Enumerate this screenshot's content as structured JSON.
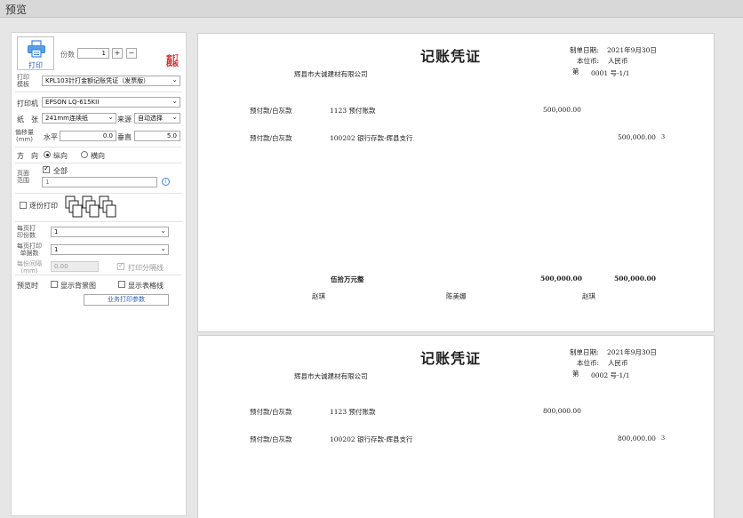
{
  "window": {
    "title": "预览"
  },
  "settings": {
    "print_label": "打印",
    "copies_label": "份数",
    "copies_value": "1",
    "plus": "+",
    "minus": "−",
    "overprint_label": "套打\n模板",
    "template_label": "打印\n模板",
    "template_value": "KPL103针打金额记账凭证（发票版）",
    "printer_label": "打印机",
    "printer_value": "EPSON LQ-615KII",
    "paper_label": "纸　张",
    "paper_value": "241mm连续纸",
    "source_label": "来源",
    "source_value": "自动选择",
    "offset_label": "偏移量\n(mm)",
    "horizontal_label": "水平",
    "horizontal_value": "0.0",
    "vertical_label": "垂直",
    "vertical_value": "5.0",
    "direction_label": "方　向",
    "portrait_label": "纵向",
    "landscape_label": "横向",
    "range_label": "页面\n范围",
    "all_label": "全部",
    "range_value": "1",
    "collate_label": "逐份打印",
    "per_page_copies_label": "每页打\n印份数",
    "per_page_copies_value": "1",
    "per_page_docs_label": "每页打印\n单据数",
    "per_page_docs_value": "1",
    "spacing_label": "每份间隔\n(mm)",
    "spacing_value": "0.00",
    "separator_label": "打印分隔线",
    "preview_label": "预览时",
    "show_bg_label": "显示背景图",
    "show_grid_label": "显示表格线",
    "biz_params_label": "业务打印参数"
  },
  "vouchers": [
    {
      "title": "记账凭证",
      "date_label": "制单日期:",
      "date": "2021年9月30日",
      "currency_label": "本位币:",
      "currency": "人民币",
      "number_label": "第",
      "number": "0001 号-1/1",
      "company": "辉县市大诚建材有限公司",
      "rows": [
        {
          "summary": "预付款/白灰款",
          "account": "1123 预付账款",
          "debit": "500,000.00",
          "credit": "",
          "mark": ""
        },
        {
          "summary": "预付款/白灰款",
          "account": "100202 银行存款-辉县支行",
          "debit": "",
          "credit": "500,000.00",
          "mark": "3"
        }
      ],
      "total_words": "伍拾万元整",
      "total_debit": "500,000.00",
      "total_credit": "500,000.00",
      "signers": [
        "赵琪",
        "陈美娜",
        "赵琪"
      ]
    },
    {
      "title": "记账凭证",
      "date_label": "制单日期:",
      "date": "2021年9月30日",
      "currency_label": "本位币:",
      "currency": "人民币",
      "number_label": "第",
      "number": "0002 号-1/1",
      "company": "辉县市大诚建材有限公司",
      "rows": [
        {
          "summary": "预付款/白灰款",
          "account": "1123 预付账款",
          "debit": "800,000.00",
          "credit": "",
          "mark": ""
        },
        {
          "summary": "预付款/白灰款",
          "account": "100202 银行存款-辉县支行",
          "debit": "",
          "credit": "800,000.00",
          "mark": "3"
        }
      ]
    }
  ]
}
